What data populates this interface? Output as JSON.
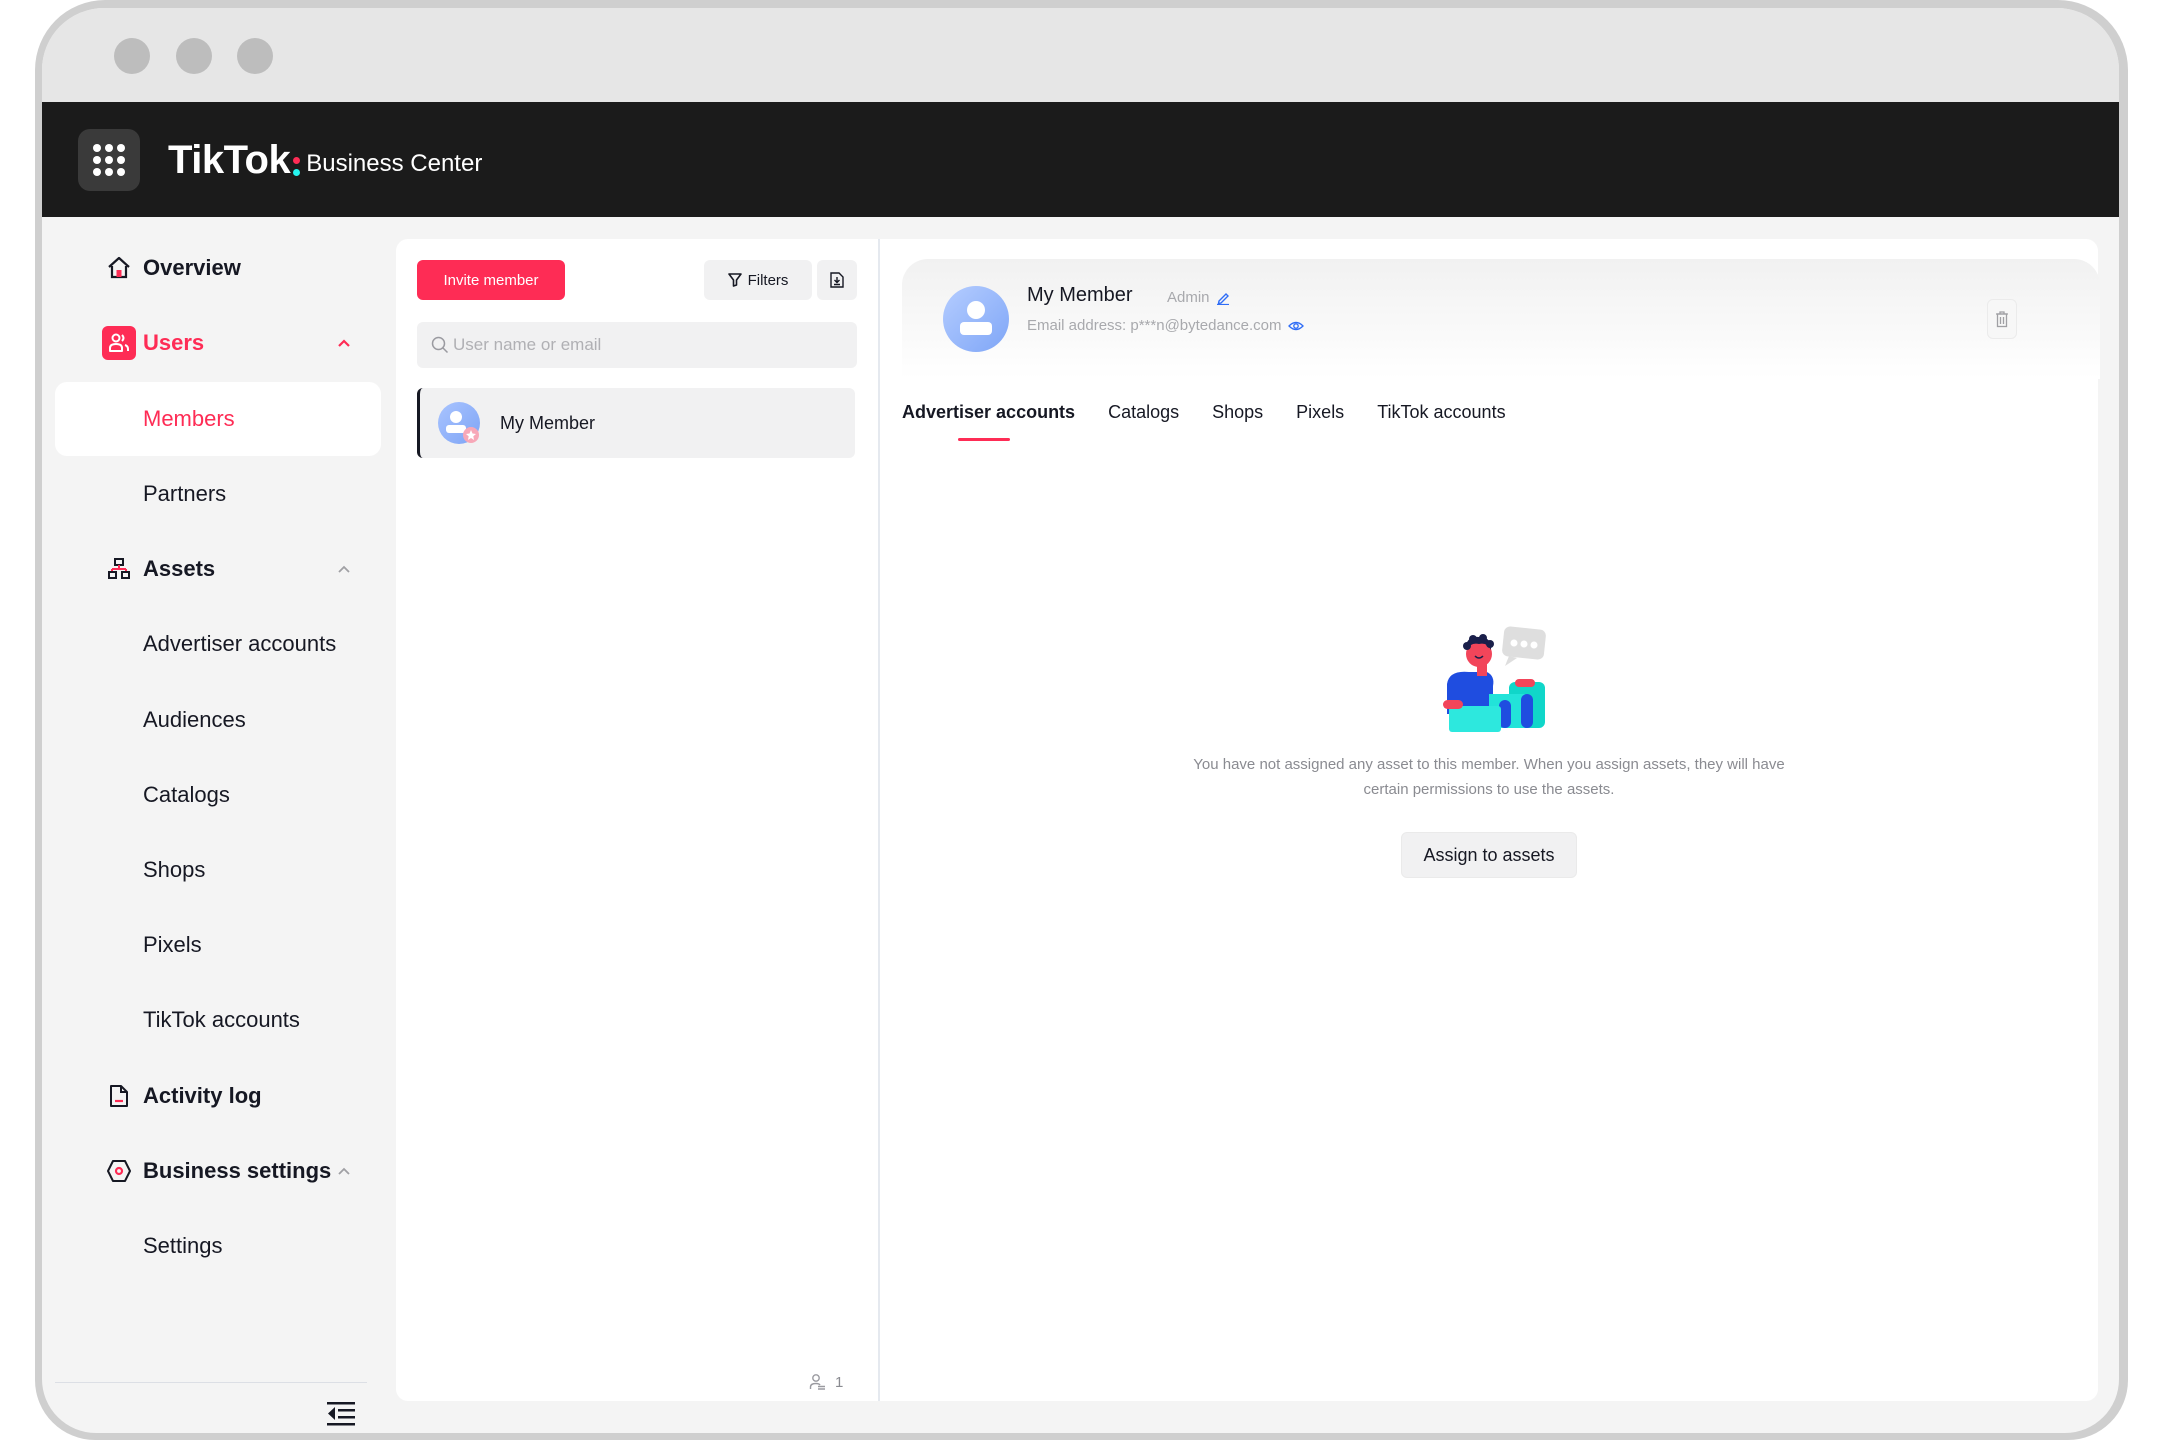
{
  "window": {
    "controls": [
      "close",
      "minimize",
      "maximize"
    ]
  },
  "header": {
    "apps_icon": "grid-icon",
    "logo": "TikTok",
    "product": "Business Center",
    "colors": {
      "brand_red": "#fe2c55",
      "brand_cyan": "#25f4ee",
      "header_bg": "#1b1b1b"
    }
  },
  "sidebar": {
    "items": [
      {
        "label": "Overview",
        "icon": "home-icon",
        "type": "parent"
      },
      {
        "label": "Users",
        "icon": "users-icon",
        "type": "parent",
        "expanded": true,
        "active": true
      },
      {
        "label": "Members",
        "type": "child",
        "selected": true
      },
      {
        "label": "Partners",
        "type": "child"
      },
      {
        "label": "Assets",
        "icon": "assets-icon",
        "type": "parent",
        "expanded": true
      },
      {
        "label": "Advertiser accounts",
        "type": "child"
      },
      {
        "label": "Audiences",
        "type": "child"
      },
      {
        "label": "Catalogs",
        "type": "child"
      },
      {
        "label": "Shops",
        "type": "child"
      },
      {
        "label": "Pixels",
        "type": "child"
      },
      {
        "label": "TikTok accounts",
        "type": "child"
      },
      {
        "label": "Activity log",
        "icon": "document-icon",
        "type": "parent"
      },
      {
        "label": "Business settings",
        "icon": "settings-hex-icon",
        "type": "parent",
        "expanded": true
      },
      {
        "label": "Settings",
        "type": "child"
      }
    ],
    "collapse_icon": "collapse-sidebar-icon"
  },
  "members_panel": {
    "invite_label": "Invite member",
    "filters_label": "Filters",
    "export_icon": "export-icon",
    "search": {
      "placeholder": "User name or email",
      "value": ""
    },
    "members": [
      {
        "name": "My Member"
      }
    ],
    "count": "1"
  },
  "detail": {
    "name": "My Member",
    "role": "Admin",
    "email_label": "Email address: p***n@bytedance.com",
    "tabs": [
      {
        "label": "Advertiser accounts",
        "active": true
      },
      {
        "label": "Catalogs"
      },
      {
        "label": "Shops"
      },
      {
        "label": "Pixels"
      },
      {
        "label": "TikTok accounts"
      }
    ],
    "empty_message": "You have not assigned any asset to this member. When you assign assets, they will have certain permissions to use the assets.",
    "assign_label": "Assign to assets"
  }
}
